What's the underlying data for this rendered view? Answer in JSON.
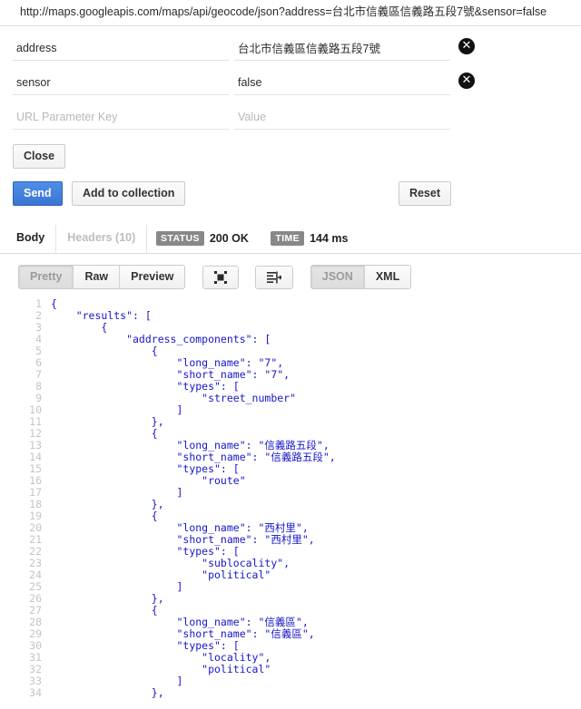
{
  "request": {
    "url": "http://maps.googleapis.com/maps/api/geocode/json?address=台北市信義區信義路五段7號&sensor=false",
    "params": [
      {
        "key": "address",
        "value": "台北市信義區信義路五段7號",
        "clear_label": "✕"
      },
      {
        "key": "sensor",
        "value": "false",
        "clear_label": "✕"
      }
    ],
    "new_param": {
      "key_placeholder": "URL Parameter Key",
      "value_placeholder": "Value",
      "key": "",
      "value": ""
    },
    "close_label": "Close",
    "send_label": "Send",
    "add_to_collection_label": "Add to collection",
    "reset_label": "Reset"
  },
  "response": {
    "tabs": [
      {
        "label": "Body",
        "active": true
      },
      {
        "label": "Headers (10)",
        "active": false
      }
    ],
    "status_badge": "STATUS",
    "status_value": "200 OK",
    "time_badge": "TIME",
    "time_value": "144 ms",
    "format_buttons": [
      {
        "label": "Pretty",
        "active": true
      },
      {
        "label": "Raw",
        "active": false
      },
      {
        "label": "Preview",
        "active": false
      }
    ],
    "icon_buttons": [
      {
        "name": "fullscreen-icon"
      },
      {
        "name": "wrap-lines-icon"
      }
    ],
    "language_buttons": [
      {
        "label": "JSON",
        "active": true
      },
      {
        "label": "XML",
        "active": false
      }
    ],
    "line_numbers": "1\n2\n3\n4\n5\n6\n7\n8\n9\n10\n11\n12\n13\n14\n15\n16\n17\n18\n19\n20\n21\n22\n23\n24\n25\n26\n27\n28\n29\n30\n31\n32\n33\n34",
    "body_text": "{\n    \"results\": [\n        {\n            \"address_components\": [\n                {\n                    \"long_name\": \"7\",\n                    \"short_name\": \"7\",\n                    \"types\": [\n                        \"street_number\"\n                    ]\n                },\n                {\n                    \"long_name\": \"信義路五段\",\n                    \"short_name\": \"信義路五段\",\n                    \"types\": [\n                        \"route\"\n                    ]\n                },\n                {\n                    \"long_name\": \"西村里\",\n                    \"short_name\": \"西村里\",\n                    \"types\": [\n                        \"sublocality\",\n                        \"political\"\n                    ]\n                },\n                {\n                    \"long_name\": \"信義區\",\n                    \"short_name\": \"信義區\",\n                    \"types\": [\n                        \"locality\",\n                        \"political\"\n                    ]\n                },"
  },
  "colors": {
    "primary_button": "#3b76d3",
    "json_string": "#1616c8",
    "badge_gray": "#888888",
    "line_number_gray": "#c4c4c4"
  }
}
